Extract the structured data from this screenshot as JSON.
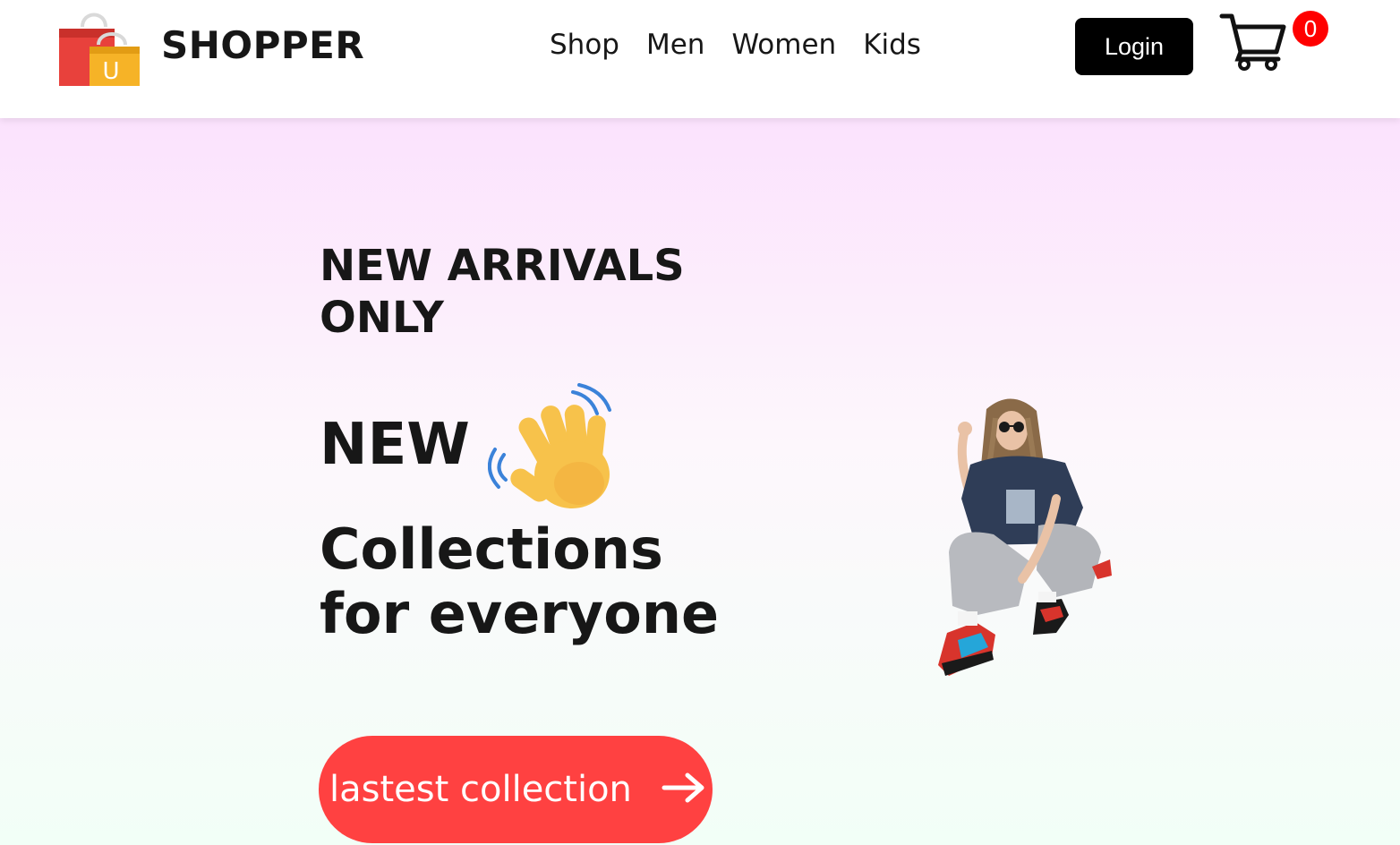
{
  "brand": {
    "name": "SHOPPER",
    "logo_icon": "shopping-bags-icon",
    "logo_letter": "U"
  },
  "nav": {
    "items": [
      {
        "label": "Shop"
      },
      {
        "label": "Men"
      },
      {
        "label": "Women"
      },
      {
        "label": "Kids"
      }
    ],
    "login_label": "Login",
    "cart_icon": "cart-icon",
    "cart_count": "0"
  },
  "hero": {
    "tagline_line1": "NEW ARRIVALS",
    "tagline_line2": "ONLY",
    "headline_word": "NEW",
    "hand_icon": "waving-hand-icon",
    "headline_line2": "Collections",
    "headline_line3": "for everyone",
    "cta_label": "lastest collection",
    "cta_icon": "arrow-right-icon",
    "image": "model-crouching-photo"
  },
  "colors": {
    "accent": "#ff4141",
    "badge": "#ff0000",
    "login_bg": "#000000",
    "hero_top": "#fbe2fd",
    "hero_bottom": "#f2fff7"
  }
}
